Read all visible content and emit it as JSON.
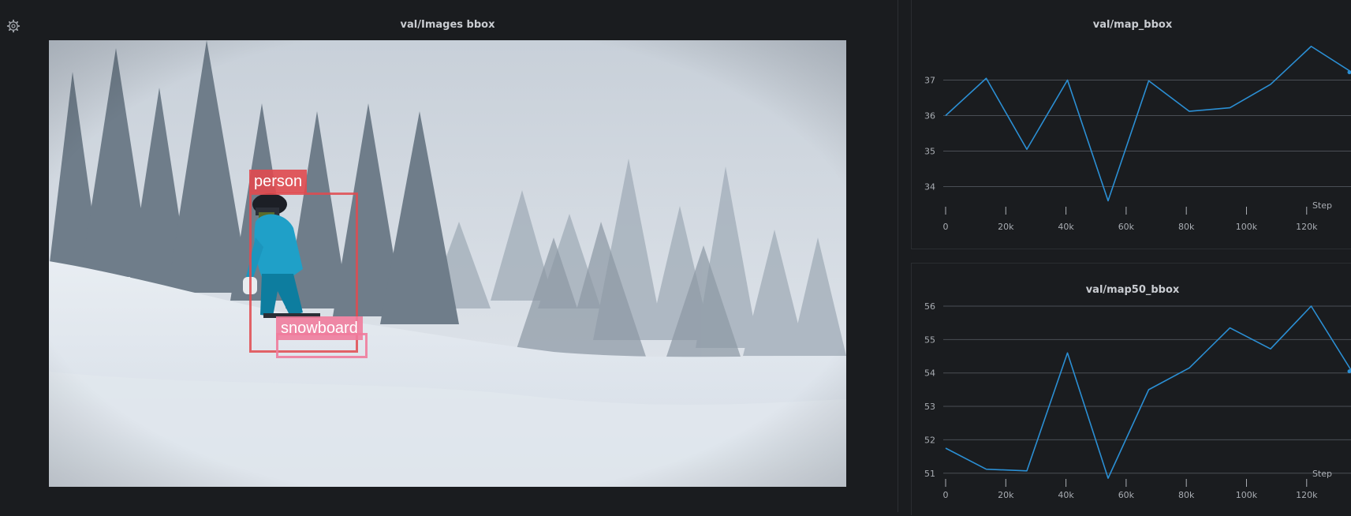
{
  "settings_icon": "gear-icon",
  "image_panel": {
    "title": "val/Images bbox",
    "boxes": [
      {
        "label": "person",
        "color": "#e04a4f"
      },
      {
        "label": "snowboard",
        "color": "#f07c9c"
      }
    ]
  },
  "chart_data": [
    {
      "type": "line",
      "title": "val/map_bbox",
      "xlabel": "Step",
      "ylabel": "",
      "color": "#2b8fd4",
      "x": [
        0,
        13500,
        27000,
        40500,
        54000,
        67500,
        81000,
        94500,
        108000,
        121500,
        135000
      ],
      "values": [
        36.0,
        37.05,
        35.05,
        37.0,
        33.6,
        36.98,
        36.12,
        36.22,
        36.88,
        37.95,
        37.22
      ],
      "xlim": [
        0,
        135000
      ],
      "ylim": [
        33.7,
        38.1
      ],
      "yticks": [
        34,
        35,
        36,
        37
      ],
      "xticks": [
        0,
        20000,
        40000,
        60000,
        80000,
        100000,
        120000
      ],
      "xtick_labels": [
        "0",
        "20k",
        "40k",
        "60k",
        "80k",
        "100k",
        "120k"
      ],
      "grid": true
    },
    {
      "type": "line",
      "title": "val/map50_bbox",
      "xlabel": "Step",
      "ylabel": "",
      "color": "#2b8fd4",
      "x": [
        0,
        13500,
        27000,
        40500,
        54000,
        67500,
        81000,
        94500,
        108000,
        121500,
        135000
      ],
      "values": [
        51.75,
        51.12,
        51.07,
        54.6,
        50.85,
        53.5,
        54.15,
        55.35,
        54.72,
        56.0,
        54.05
      ],
      "xlim": [
        0,
        135000
      ],
      "ylim": [
        50.9,
        56.0
      ],
      "yticks": [
        51,
        52,
        53,
        54,
        55,
        56
      ],
      "xticks": [
        0,
        20000,
        40000,
        60000,
        80000,
        100000,
        120000
      ],
      "xtick_labels": [
        "0",
        "20k",
        "40k",
        "60k",
        "80k",
        "100k",
        "120k"
      ],
      "grid": true
    }
  ]
}
